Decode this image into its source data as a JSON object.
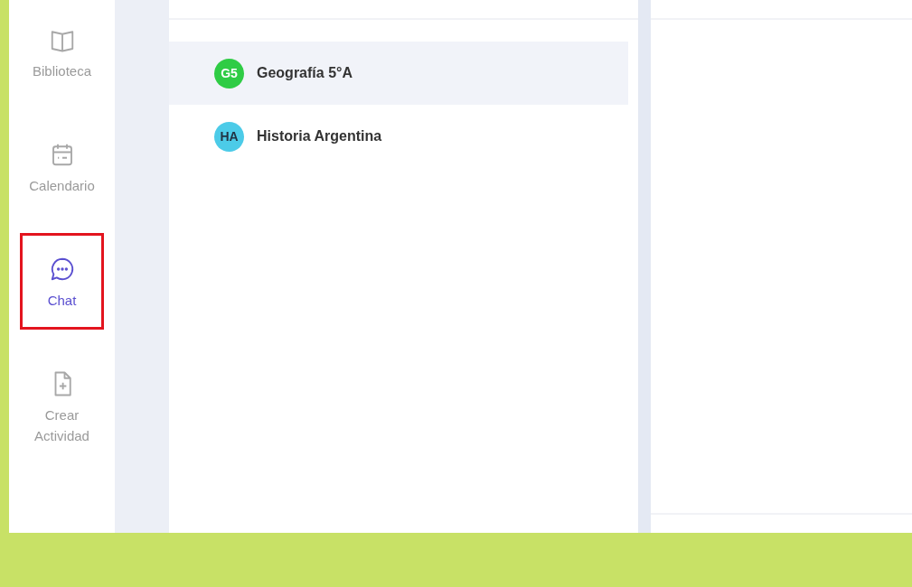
{
  "sidebar": {
    "items": [
      {
        "label": "Biblioteca",
        "selected": false,
        "highlighted": false
      },
      {
        "label": "Calendario",
        "selected": false,
        "highlighted": false
      },
      {
        "label": "Chat",
        "selected": true,
        "highlighted": true
      },
      {
        "label": "Crear Actividad",
        "selected": false,
        "highlighted": false
      }
    ]
  },
  "conversations": [
    {
      "initials": "G5",
      "name": "Geografía 5°A",
      "color": "#2fcc45",
      "selected": true
    },
    {
      "initials": "HA",
      "name": "Historia Argentina",
      "color": "#4ccbe8",
      "selected": false
    }
  ]
}
